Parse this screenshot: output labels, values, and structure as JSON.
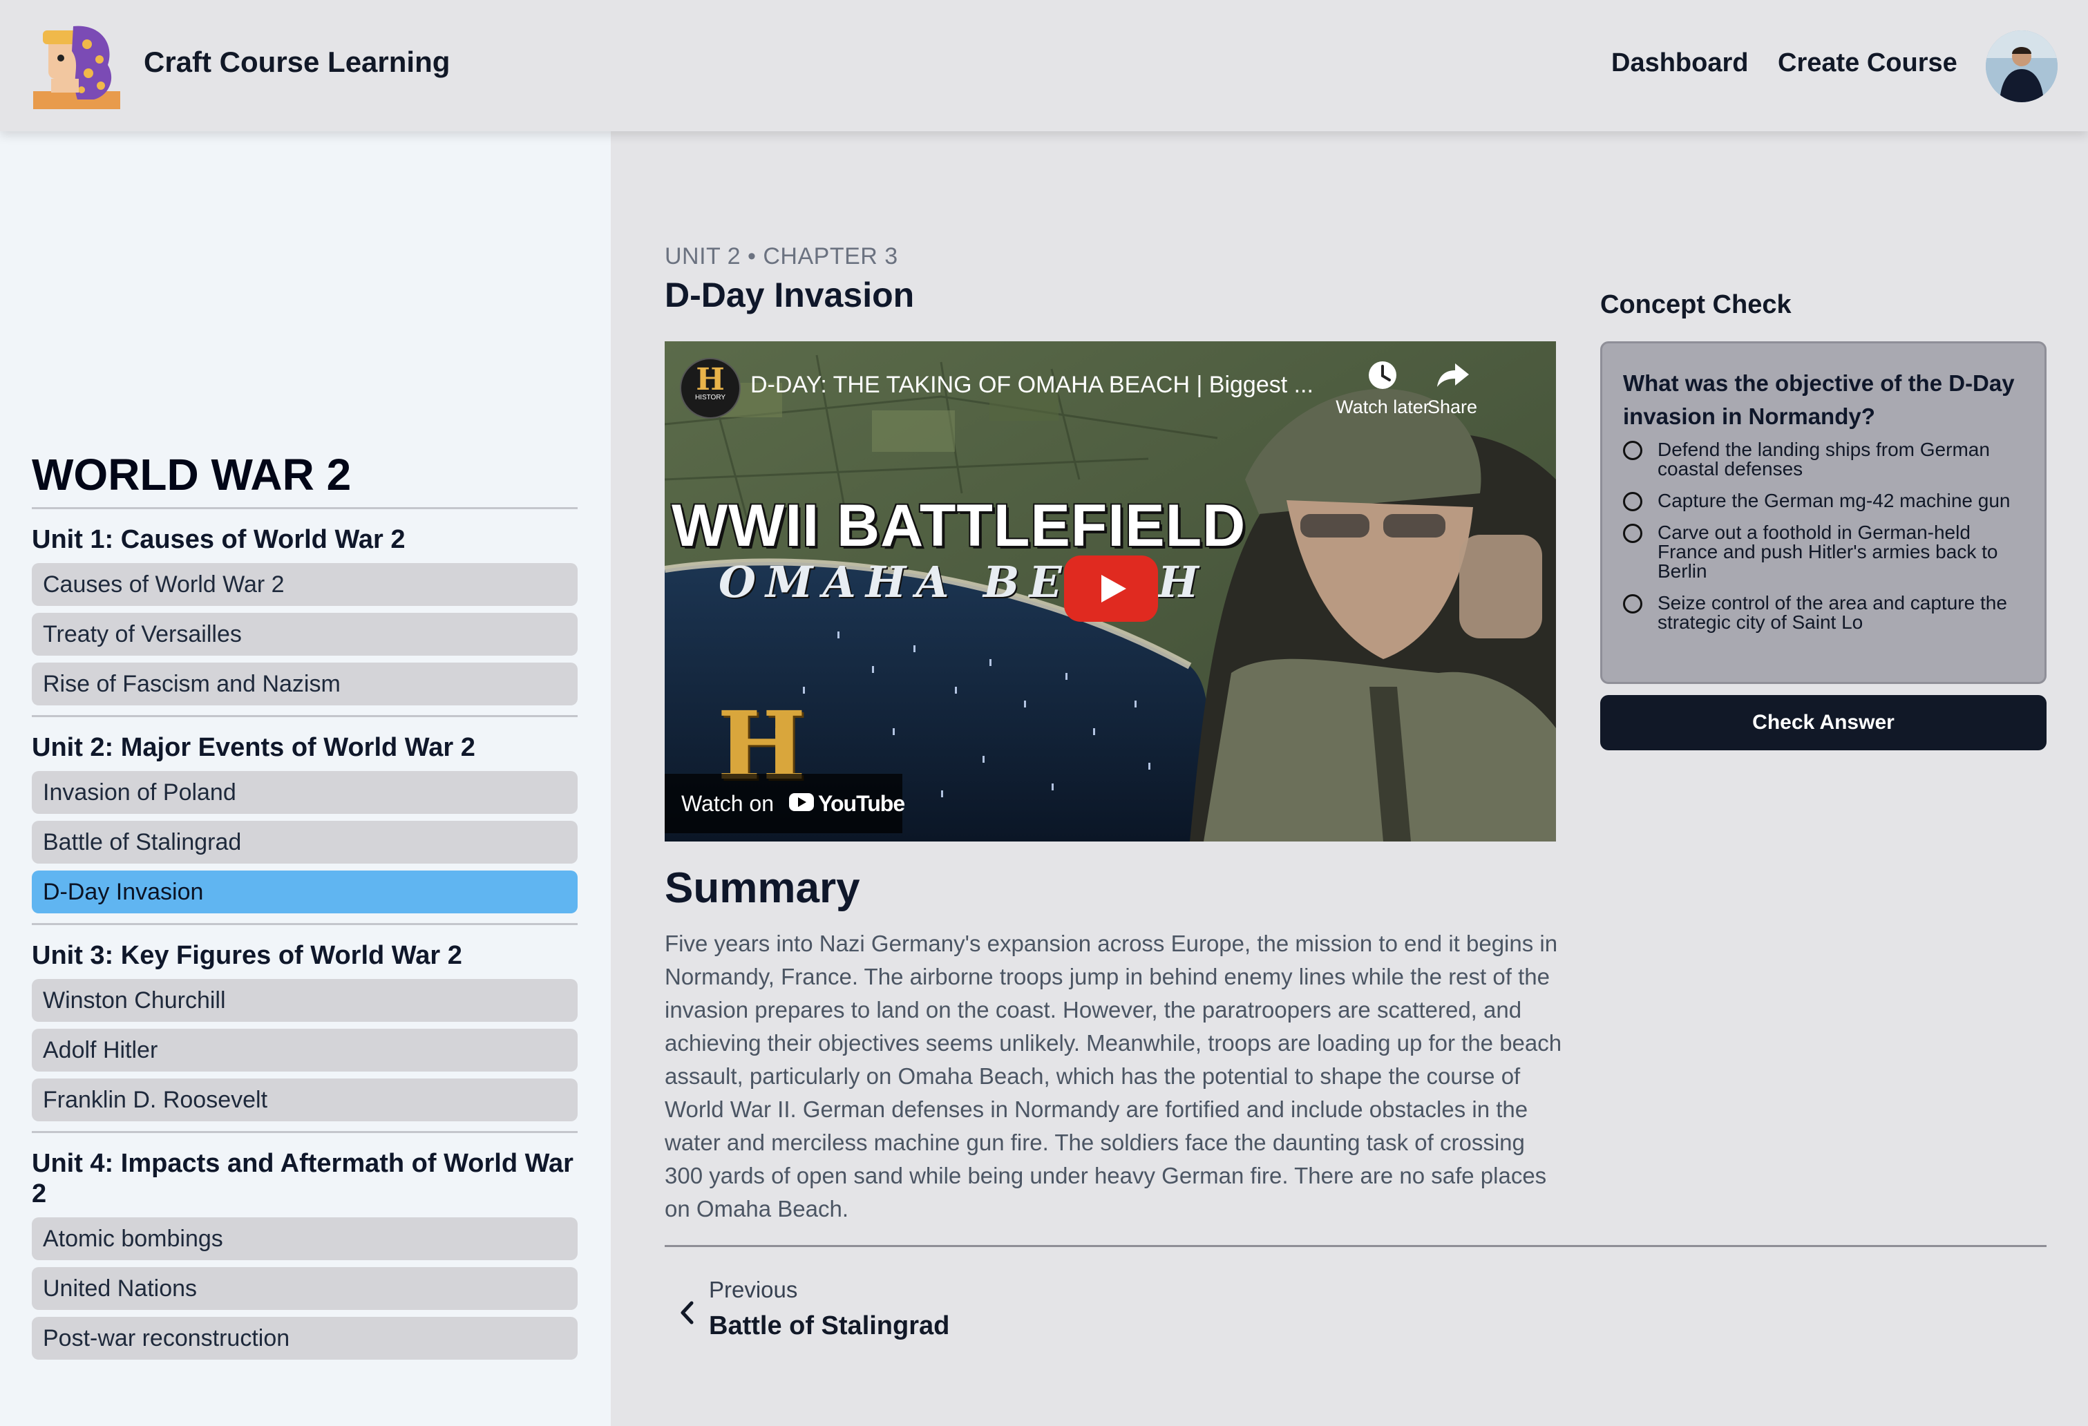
{
  "navbar": {
    "brand": "Craft Course Learning",
    "links": {
      "dashboard": "Dashboard",
      "create_course": "Create Course"
    },
    "avatar_icon": "user-avatar-icon"
  },
  "sidebar": {
    "course_title": "WORLD WAR 2",
    "units": [
      {
        "title": "Unit 1: Causes of World War 2",
        "chapters": [
          "Causes of World War 2",
          "Treaty of Versailles",
          "Rise of Fascism and Nazism"
        ]
      },
      {
        "title": "Unit 2: Major Events of World War 2",
        "chapters": [
          "Invasion of Poland",
          "Battle of Stalingrad",
          "D-Day Invasion"
        ]
      },
      {
        "title": "Unit 3: Key Figures of World War 2",
        "chapters": [
          "Winston Churchill",
          "Adolf Hitler",
          "Franklin D. Roosevelt"
        ]
      },
      {
        "title": "Unit 4: Impacts and Aftermath of World War 2",
        "chapters": [
          "Atomic bombings",
          "United Nations",
          "Post-war reconstruction"
        ]
      }
    ],
    "active_chapter": "D-Day Invasion",
    "active_color": "#60b5f1"
  },
  "main": {
    "breadcrumb": "UNIT 2 • CHAPTER 3",
    "chapter_title": "D-Day Invasion",
    "video": {
      "title": "D-DAY: THE TAKING OF OMAHA BEACH | Biggest ...",
      "channel_badge": "H",
      "channel_badge_sub": "HISTORY",
      "watch_later": "Watch later",
      "share": "Share",
      "thumbnail_title": "WWII BATTLEFIELD",
      "thumbnail_subtitle": "OMAHA BEACH",
      "thumbnail_logo": "H",
      "watch_on": "Watch on",
      "youtube": "YouTube",
      "play_color": "#e02a20"
    },
    "summary_title": "Summary",
    "summary_text": "Five years into Nazi Germany's expansion across Europe, the mission to end it begins in Normandy, France. The airborne troops jump in behind enemy lines while the rest of the invasion prepares to land on the coast. However, the paratroopers are scattered, and achieving their objectives seems unlikely. Meanwhile, troops are loading up for the beach assault, particularly on Omaha Beach, which has the potential to shape the course of World War II. German defenses in Normandy are fortified and include obstacles in the water and merciless machine gun fire. The soldiers face the daunting task of crossing 300 yards of open sand while being under heavy German fire. There are no safe places on Omaha Beach.",
    "prev": {
      "label": "Previous",
      "title": "Battle of Stalingrad"
    }
  },
  "concept_check": {
    "heading": "Concept Check",
    "question": "What was the objective of the D-Day invasion in Normandy?",
    "options": [
      "Defend the landing ships from German coastal defenses",
      "Capture the German mg-42 machine gun",
      "Carve out a foothold in German-held France and push Hitler's armies back to Berlin",
      "Seize control of the area and capture the strategic city of Saint Lo"
    ],
    "button": "Check Answer"
  }
}
